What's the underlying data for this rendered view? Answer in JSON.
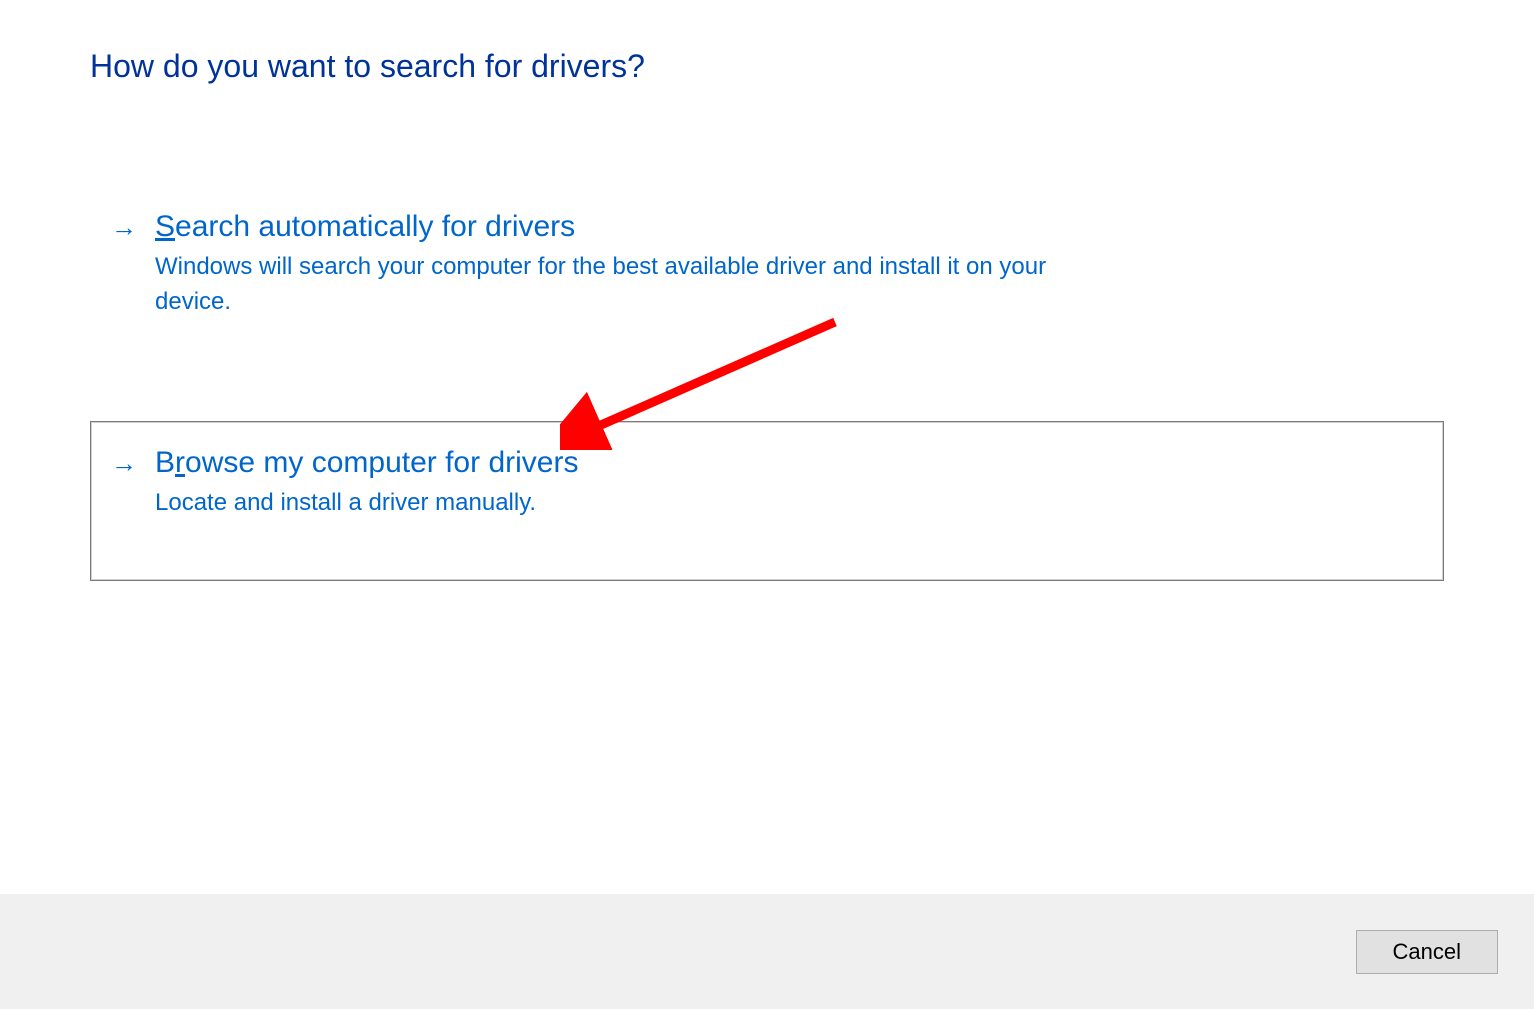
{
  "title": "How do you want to search for drivers?",
  "options": [
    {
      "title_pre_mnemonic": "",
      "mnemonic": "S",
      "title_post_mnemonic": "earch automatically for drivers",
      "description": "Windows will search your computer for the best available driver and install it on your device."
    },
    {
      "title_pre_mnemonic": "B",
      "mnemonic": "r",
      "title_post_mnemonic": "owse my computer for drivers",
      "description": "Locate and install a driver manually."
    }
  ],
  "footer": {
    "cancel_label": "Cancel"
  },
  "colors": {
    "title_blue": "#003399",
    "link_blue": "#0066cc",
    "annotation_red": "#ff0000",
    "footer_bg": "#f0f0f0",
    "button_bg": "#e1e1e1"
  }
}
